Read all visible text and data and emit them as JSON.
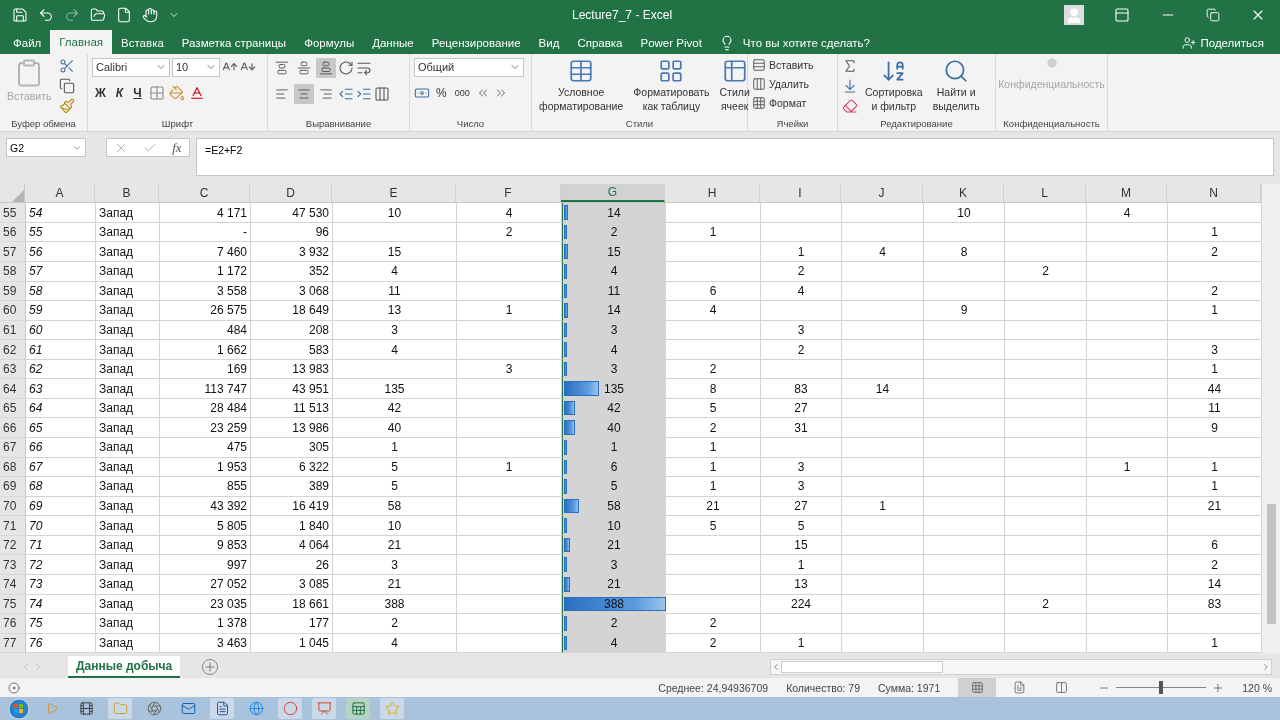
{
  "window": {
    "title": "Lecture7_7  -  Excel"
  },
  "ribbon_tabs": [
    {
      "label": "Файл",
      "selected": false
    },
    {
      "label": "Главная",
      "selected": true
    },
    {
      "label": "Вставка",
      "selected": false
    },
    {
      "label": "Разметка страницы",
      "selected": false
    },
    {
      "label": "Формулы",
      "selected": false
    },
    {
      "label": "Данные",
      "selected": false
    },
    {
      "label": "Рецензирование",
      "selected": false
    },
    {
      "label": "Вид",
      "selected": false
    },
    {
      "label": "Справка",
      "selected": false
    },
    {
      "label": "Power Pivot",
      "selected": false
    }
  ],
  "tell_me": {
    "placeholder": "Что вы хотите сделать?"
  },
  "share": "Поделиться",
  "ribbon": {
    "clipboard": {
      "label": "Буфер обмена",
      "paste": {
        "label": "Вставить",
        "disabled": true
      }
    },
    "font": {
      "label": "Шрифт",
      "family": "Calibri",
      "size": "10",
      "bold": "Ж",
      "italic": "К",
      "underline": "Ч"
    },
    "alignment": {
      "label": "Выравнивание",
      "vertical": [
        {
          "selected": false
        },
        {
          "selected": false
        },
        {
          "selected": true
        }
      ],
      "horizontal": [
        {
          "selected": false
        },
        {
          "selected": true
        },
        {
          "selected": false
        }
      ]
    },
    "number": {
      "label": "Число",
      "format": "Общий",
      "percent": "%",
      "thousands": "000"
    },
    "styles": {
      "label": "Стили",
      "buttons": [
        {
          "lines": [
            "Условное",
            "форматирование"
          ]
        },
        {
          "lines": [
            "Форматировать",
            "как таблицу"
          ]
        },
        {
          "lines": [
            "Стили",
            "ячеек"
          ]
        }
      ]
    },
    "cells": {
      "label": "Ячейки",
      "buttons": [
        "Вставить",
        "Удалить",
        "Формат"
      ]
    },
    "editing": {
      "label": "Редактирование",
      "buttons": [
        {
          "lines": [
            "Сортировка",
            "и фильтр"
          ]
        },
        {
          "lines": [
            "Найти и",
            "выделить"
          ]
        }
      ]
    },
    "sensitivity": {
      "label": "Конфиденциальность",
      "button": {
        "label": "Конфиденциальность",
        "disabled": true
      }
    }
  },
  "formula_bar": {
    "name_box": "G2",
    "function_label": "fx",
    "formula": "=E2+F2"
  },
  "columns": [
    {
      "label": "A",
      "selected": false
    },
    {
      "label": "B",
      "selected": false
    },
    {
      "label": "C",
      "selected": false
    },
    {
      "label": "D",
      "selected": false
    },
    {
      "label": "E",
      "selected": false
    },
    {
      "label": "F",
      "selected": false
    },
    {
      "label": "G",
      "selected": true
    },
    {
      "label": "H",
      "selected": false
    },
    {
      "label": "I",
      "selected": false
    },
    {
      "label": "J",
      "selected": false
    },
    {
      "label": "K",
      "selected": false
    },
    {
      "label": "L",
      "selected": false
    },
    {
      "label": "M",
      "selected": false
    },
    {
      "label": "N",
      "selected": false
    }
  ],
  "rows": [
    {
      "num": "55",
      "level": 0.036,
      "cells": [
        "54",
        "Запад",
        "4 171",
        "47 530",
        "10",
        "4",
        "14",
        null,
        null,
        null,
        "10",
        null,
        "4",
        null
      ]
    },
    {
      "num": "56",
      "level": 0.005,
      "cells": [
        "55",
        "Запад",
        "-",
        "96",
        null,
        "2",
        "2",
        "1",
        null,
        null,
        null,
        null,
        null,
        "1"
      ]
    },
    {
      "num": "57",
      "level": 0.039,
      "cells": [
        "56",
        "Запад",
        "7 460",
        "3 932",
        "15",
        null,
        "15",
        null,
        "1",
        "4",
        "8",
        null,
        null,
        "2"
      ]
    },
    {
      "num": "58",
      "level": 0.01,
      "cells": [
        "57",
        "Запад",
        "1 172",
        "352",
        "4",
        null,
        "4",
        null,
        "2",
        null,
        null,
        "2",
        null,
        null
      ]
    },
    {
      "num": "59",
      "level": 0.028,
      "cells": [
        "58",
        "Запад",
        "3 558",
        "3 068",
        "11",
        null,
        "11",
        "6",
        "4",
        null,
        null,
        null,
        null,
        "2"
      ]
    },
    {
      "num": "60",
      "level": 0.036,
      "cells": [
        "59",
        "Запад",
        "26 575",
        "18 649",
        "13",
        "1",
        "14",
        "4",
        null,
        null,
        "9",
        null,
        null,
        "1"
      ]
    },
    {
      "num": "61",
      "level": 0.008,
      "cells": [
        "60",
        "Запад",
        "484",
        "208",
        "3",
        null,
        "3",
        null,
        "3",
        null,
        null,
        null,
        null,
        null
      ]
    },
    {
      "num": "62",
      "level": 0.01,
      "cells": [
        "61",
        "Запад",
        "1 662",
        "583",
        "4",
        null,
        "4",
        null,
        "2",
        null,
        null,
        null,
        null,
        "3"
      ]
    },
    {
      "num": "63",
      "level": 0.008,
      "cells": [
        "62",
        "Запад",
        "169",
        "13 983",
        null,
        "3",
        "3",
        "2",
        null,
        null,
        null,
        null,
        null,
        "1"
      ]
    },
    {
      "num": "64",
      "level": 0.348,
      "cells": [
        "63",
        "Запад",
        "113 747",
        "43 951",
        "135",
        null,
        "135",
        "8",
        "83",
        "14",
        null,
        null,
        null,
        "44"
      ]
    },
    {
      "num": "65",
      "level": 0.108,
      "cells": [
        "64",
        "Запад",
        "28 484",
        "11 513",
        "42",
        null,
        "42",
        "5",
        "27",
        null,
        null,
        null,
        null,
        "11"
      ]
    },
    {
      "num": "66",
      "level": 0.103,
      "cells": [
        "65",
        "Запад",
        "23 259",
        "13 986",
        "40",
        null,
        "40",
        "2",
        "31",
        null,
        null,
        null,
        null,
        "9"
      ]
    },
    {
      "num": "67",
      "level": 0.003,
      "cells": [
        "66",
        "Запад",
        "475",
        "305",
        "1",
        null,
        "1",
        "1",
        null,
        null,
        null,
        null,
        null,
        null
      ]
    },
    {
      "num": "68",
      "level": 0.015,
      "cells": [
        "67",
        "Запад",
        "1 953",
        "6 322",
        "5",
        "1",
        "6",
        "1",
        "3",
        null,
        null,
        null,
        "1",
        "1"
      ]
    },
    {
      "num": "69",
      "level": 0.013,
      "cells": [
        "68",
        "Запад",
        "855",
        "389",
        "5",
        null,
        "5",
        "1",
        "3",
        null,
        null,
        null,
        null,
        "1"
      ]
    },
    {
      "num": "70",
      "level": 0.149,
      "cells": [
        "69",
        "Запад",
        "43 392",
        "16 419",
        "58",
        null,
        "58",
        "21",
        "27",
        "1",
        null,
        null,
        null,
        "21"
      ]
    },
    {
      "num": "71",
      "level": 0.026,
      "cells": [
        "70",
        "Запад",
        "5 805",
        "1 840",
        "10",
        null,
        "10",
        "5",
        "5",
        null,
        null,
        null,
        null,
        null
      ]
    },
    {
      "num": "72",
      "level": 0.054,
      "cells": [
        "71",
        "Запад",
        "9 853",
        "4 064",
        "21",
        null,
        "21",
        null,
        "15",
        null,
        null,
        null,
        null,
        "6"
      ]
    },
    {
      "num": "73",
      "level": 0.008,
      "cells": [
        "72",
        "Запад",
        "997",
        "26",
        "3",
        null,
        "3",
        null,
        "1",
        null,
        null,
        null,
        null,
        "2"
      ]
    },
    {
      "num": "74",
      "level": 0.054,
      "cells": [
        "73",
        "Запад",
        "27 052",
        "3 085",
        "21",
        null,
        "21",
        null,
        "13",
        null,
        null,
        null,
        null,
        "14"
      ]
    },
    {
      "num": "75",
      "level": 1,
      "cells": [
        "74",
        "Запад",
        "23 035",
        "18 661",
        "388",
        null,
        "388",
        null,
        "224",
        null,
        null,
        "2",
        null,
        "83"
      ]
    },
    {
      "num": "76",
      "level": 0.005,
      "cells": [
        "75",
        "Запад",
        "1 378",
        "177",
        "2",
        null,
        "2",
        "2",
        null,
        null,
        null,
        null,
        null,
        null
      ]
    },
    {
      "num": "77",
      "level": 0.01,
      "cells": [
        "76",
        "Запад",
        "3 463",
        "1 045",
        "4",
        null,
        "4",
        "2",
        "1",
        null,
        null,
        null,
        null,
        "1"
      ]
    }
  ],
  "sheet_tabs": [
    {
      "label": "Данные добыча",
      "selected": true
    }
  ],
  "status_bar": {
    "average": "Среднее: 24,94936709",
    "count": "Количество: 79",
    "sum": "Сумма: 1971",
    "views": [
      {
        "selected": true
      },
      {
        "selected": false
      },
      {
        "selected": false
      }
    ],
    "zoom": {
      "level": 0.5,
      "reading": "120 %"
    }
  }
}
